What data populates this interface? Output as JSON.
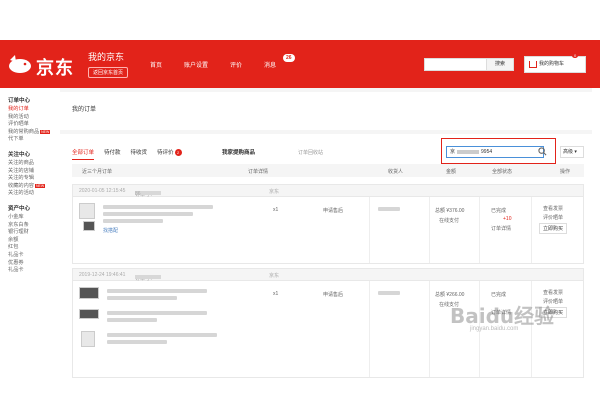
{
  "header": {
    "brand": "京东",
    "my_jd": "我的京东",
    "home_button": "返回京东首页",
    "nav": [
      "首页",
      "账户设置",
      "评价",
      "消息"
    ],
    "message_count": "26",
    "search_button": "搜索",
    "cart_label": "我的购物车",
    "cart_count": "0"
  },
  "sidebar": {
    "groups": [
      {
        "head": "订单中心",
        "items": [
          {
            "label": "我的订单",
            "active": true
          },
          {
            "label": "我的活动"
          },
          {
            "label": "评价晒单"
          },
          {
            "label": "我的常购商品",
            "new": true
          },
          {
            "label": "代下单"
          }
        ]
      },
      {
        "head": "关注中心",
        "items": [
          {
            "label": "关注的商品"
          },
          {
            "label": "关注的店铺"
          },
          {
            "label": "关注的专辑"
          },
          {
            "label": "收藏的内容",
            "new": true
          },
          {
            "label": "关注的活动"
          }
        ]
      },
      {
        "head": "资产中心",
        "items": [
          {
            "label": "小金库"
          },
          {
            "label": "京东白条"
          },
          {
            "label": "银行理财"
          },
          {
            "label": "余额"
          },
          {
            "label": "红包"
          },
          {
            "label": "礼品卡"
          },
          {
            "label": "优惠券"
          },
          {
            "label": "礼品卡"
          }
        ]
      }
    ]
  },
  "main": {
    "title": "我的订单",
    "tabs": [
      "全部订单",
      "待付款",
      "待收货",
      "待评价"
    ],
    "pending_review_count": "2",
    "extra_tab": "我家提购商品",
    "recycle": "订单回收站",
    "search_value_prefix": "京",
    "search_value_suffix": "9954",
    "more_button": "高级",
    "columns": {
      "period": "近三个月订单",
      "detail": "订单详情",
      "receiver": "收货人",
      "amount": "金额",
      "status": "全部状态",
      "action": "操作"
    },
    "orders": [
      {
        "datetime": "2020-01-05 12:15:45",
        "order_label": "订单号：",
        "order_prefix": "1D",
        "order_suffix": "86",
        "shop": "京东",
        "qty": "x1",
        "service": "申请售后",
        "amount": "总额 ¥376.00",
        "pay": "在线支付",
        "status": "已完成",
        "status_extra": "+10",
        "details": "订单详情",
        "actions": [
          "查看发票",
          "评价晒单",
          "立即购买"
        ]
      },
      {
        "datetime": "2019-12-24 19:46:41",
        "order_label": "订单号：",
        "order_prefix": "1D",
        "order_suffix": "",
        "shop": "京东",
        "qty": "x1",
        "service": "申请售后",
        "amount": "总额 ¥266.00",
        "pay": "在线支付",
        "status": "已完成",
        "status_extra": "",
        "details": "订单详情",
        "actions": [
          "查看发票",
          "评价晒单",
          "立即购买"
        ]
      }
    ],
    "item_tag": "找搭配"
  },
  "watermark": {
    "logo": "Baidu经验",
    "url": "jingyan.baidu.com"
  },
  "colors": {
    "brand_red": "#e2231a",
    "link_blue": "#4a90d9"
  }
}
